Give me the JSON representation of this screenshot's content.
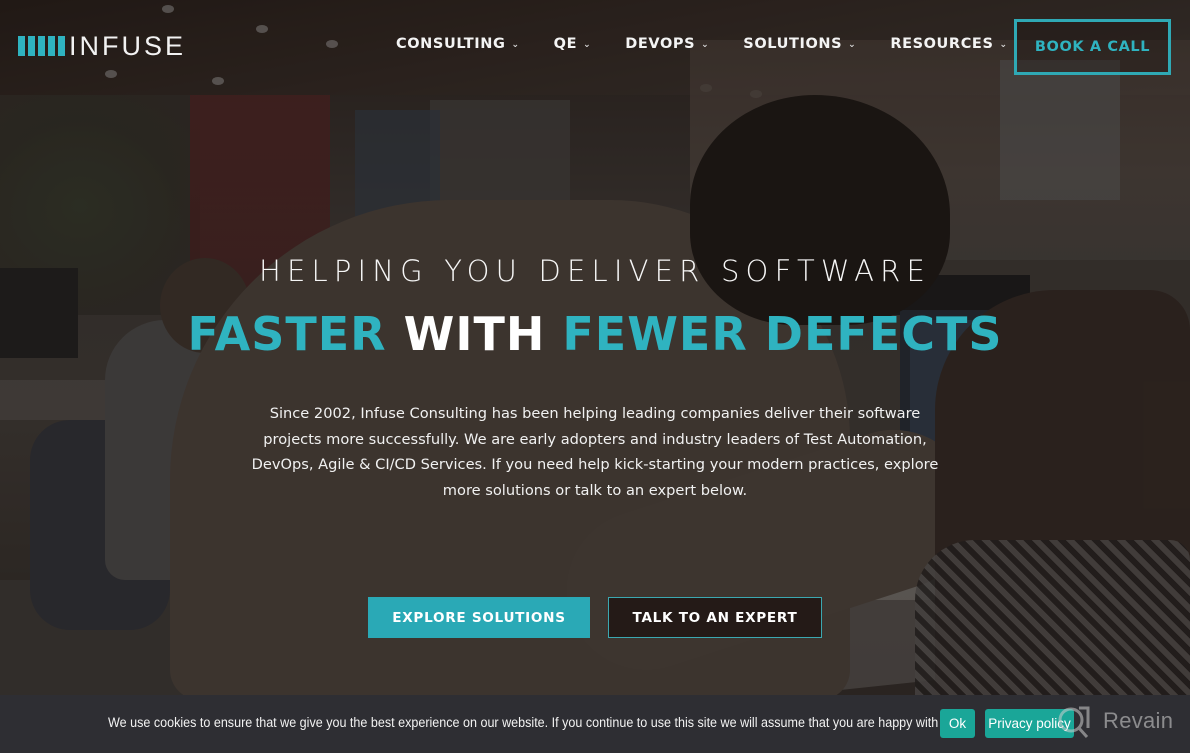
{
  "brand": {
    "name": "INFUSE",
    "bar_count": 5,
    "accent_color": "#2fb3c0"
  },
  "nav": {
    "items": [
      {
        "label": "CONSULTING",
        "icon": "chevron-down-icon"
      },
      {
        "label": "QE",
        "icon": "chevron-down-icon"
      },
      {
        "label": "DEVOPS",
        "icon": "chevron-down-icon"
      },
      {
        "label": "SOLUTIONS",
        "icon": "chevron-down-icon"
      },
      {
        "label": "RESOURCES",
        "icon": "chevron-down-icon"
      }
    ],
    "cta_label": "BOOK A CALL"
  },
  "hero": {
    "subtitle": "HELPING YOU DELIVER SOFTWARE",
    "title": {
      "part1": "FASTER",
      "part2": "WITH",
      "part3": "FEWER DEFECTS"
    },
    "description": "Since 2002, Infuse Consulting has been helping leading companies deliver their software projects more successfully. We are early adopters and industry leaders of Test Automation, DevOps, Agile & CI/CD Services. If you need help kick-starting your modern practices, explore more solutions or talk to an expert below.",
    "primary_button": "EXPLORE SOLUTIONS",
    "secondary_button": "TALK TO AN EXPERT"
  },
  "cookie_bar": {
    "message": "We use cookies to ensure that we give you the best experience on our website. If you continue to use this site we will assume that you are happy with it.",
    "ok_label": "Ok",
    "privacy_label": "Privacy policy",
    "button_color": "#1aa698"
  },
  "watermark": {
    "text": "Revain"
  }
}
